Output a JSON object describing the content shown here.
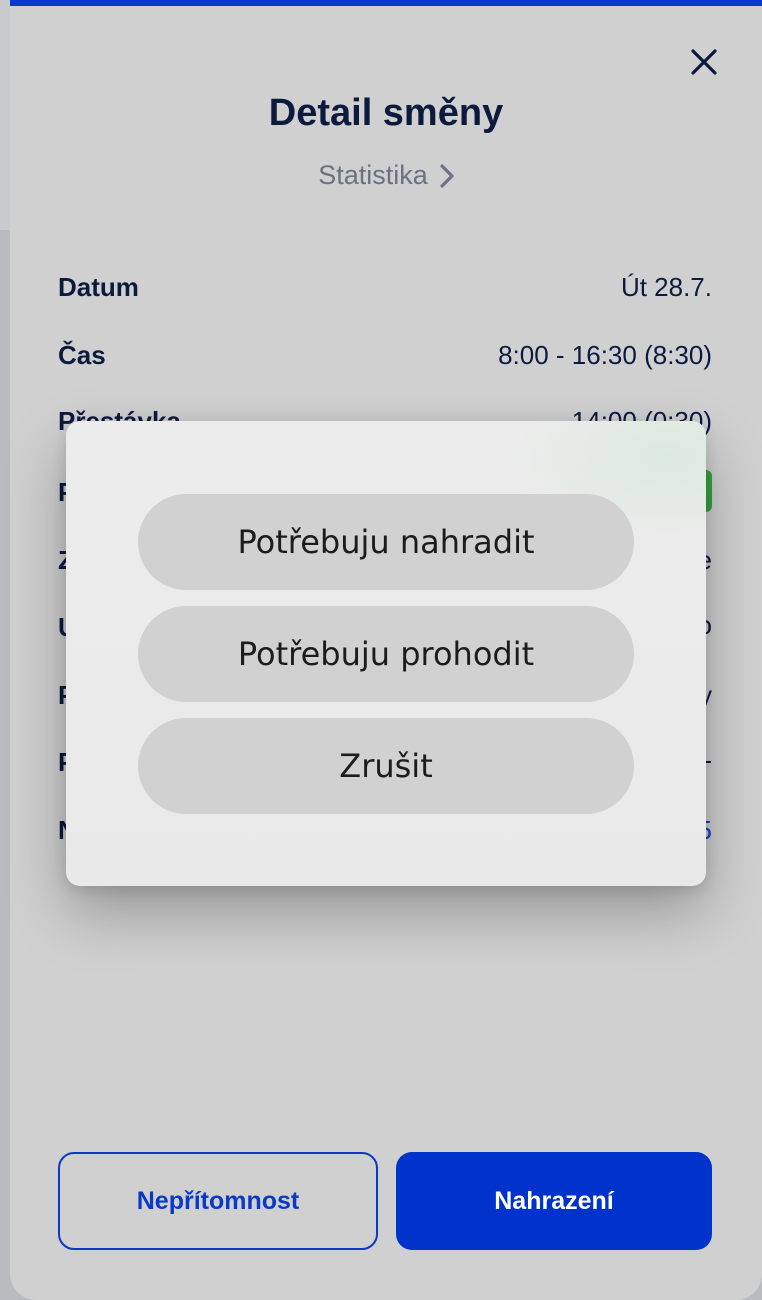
{
  "header": {
    "title": "Detail směny",
    "statistics_link": "Statistika",
    "close_icon": "close-icon"
  },
  "details": {
    "rows": [
      {
        "label": "Datum",
        "value": "Út 28.7."
      },
      {
        "label": "Čas",
        "value": "8:00 - 16:30 (8:30)"
      },
      {
        "label": "Přestávka",
        "value": "14:00 (0:30)"
      }
    ],
    "partial_labels": [
      "P",
      "Z",
      "U",
      "P",
      "P",
      "N"
    ],
    "partial_values": [
      "e",
      "o",
      "y",
      "-",
      "5"
    ]
  },
  "footer": {
    "absence_button": "Nepřítomnost",
    "replacement_button": "Nahrazení"
  },
  "popup": {
    "options": [
      "Potřebuju nahradit",
      "Potřebuju prohodit",
      "Zrušit"
    ]
  },
  "colors": {
    "accent": "#0033cc",
    "title_text": "#0b1a3d",
    "badge_green": "#3aa341"
  }
}
